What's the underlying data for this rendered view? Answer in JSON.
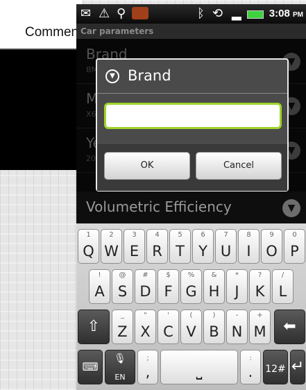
{
  "background_app": {
    "comment_label": "Commen"
  },
  "statusbar": {
    "icons": [
      "mail-icon",
      "warning-icon",
      "usb-icon",
      "app-icon",
      "bluetooth-icon",
      "sync-icon",
      "signal-icon",
      "battery-icon"
    ],
    "time": "3:08",
    "ampm": "PM"
  },
  "titlebar": {
    "title": "Car parameters"
  },
  "list": {
    "items": [
      {
        "label": "Brand",
        "sub": "BMW"
      },
      {
        "label": "Model",
        "sub": "X6"
      },
      {
        "label": "Year",
        "sub": "2009"
      },
      {
        "label": "Volumetric Efficiency",
        "sub": ""
      }
    ]
  },
  "dialog": {
    "title": "Brand",
    "input_value": "",
    "ok_label": "OK",
    "cancel_label": "Cancel"
  },
  "keyboard": {
    "row1": [
      {
        "main": "Q",
        "alt": "1"
      },
      {
        "main": "W",
        "alt": "2"
      },
      {
        "main": "E",
        "alt": "3"
      },
      {
        "main": "R",
        "alt": "4"
      },
      {
        "main": "T",
        "alt": "5"
      },
      {
        "main": "Y",
        "alt": "6"
      },
      {
        "main": "U",
        "alt": "7"
      },
      {
        "main": "I",
        "alt": "8"
      },
      {
        "main": "O",
        "alt": "9"
      },
      {
        "main": "P",
        "alt": "0"
      }
    ],
    "row2": [
      {
        "main": "A",
        "alt": "!"
      },
      {
        "main": "S",
        "alt": "@"
      },
      {
        "main": "D",
        "alt": "#"
      },
      {
        "main": "F",
        "alt": "$"
      },
      {
        "main": "G",
        "alt": "%"
      },
      {
        "main": "H",
        "alt": "&"
      },
      {
        "main": "J",
        "alt": "*"
      },
      {
        "main": "K",
        "alt": "?"
      },
      {
        "main": "L",
        "alt": "/"
      }
    ],
    "row3": [
      {
        "main": "Z",
        "alt": "_"
      },
      {
        "main": "X",
        "alt": "\""
      },
      {
        "main": "C",
        "alt": "'"
      },
      {
        "main": "V",
        "alt": "("
      },
      {
        "main": "B",
        "alt": ")"
      },
      {
        "main": "N",
        "alt": "-"
      },
      {
        "main": "M",
        "alt": "+"
      }
    ],
    "shift_icon": "shift-icon",
    "backspace_icon": "backspace-icon",
    "keyboard_icon": "keyboard-icon",
    "mic_label": "EN",
    "comma": ",",
    "comma_alt": ";",
    "period": ".",
    "period_alt": ":",
    "symbols_label": "12#",
    "enter_icon": "enter-icon"
  },
  "colors": {
    "input_border": "#9fd32a",
    "screen_bg": "#0e0e0e"
  }
}
